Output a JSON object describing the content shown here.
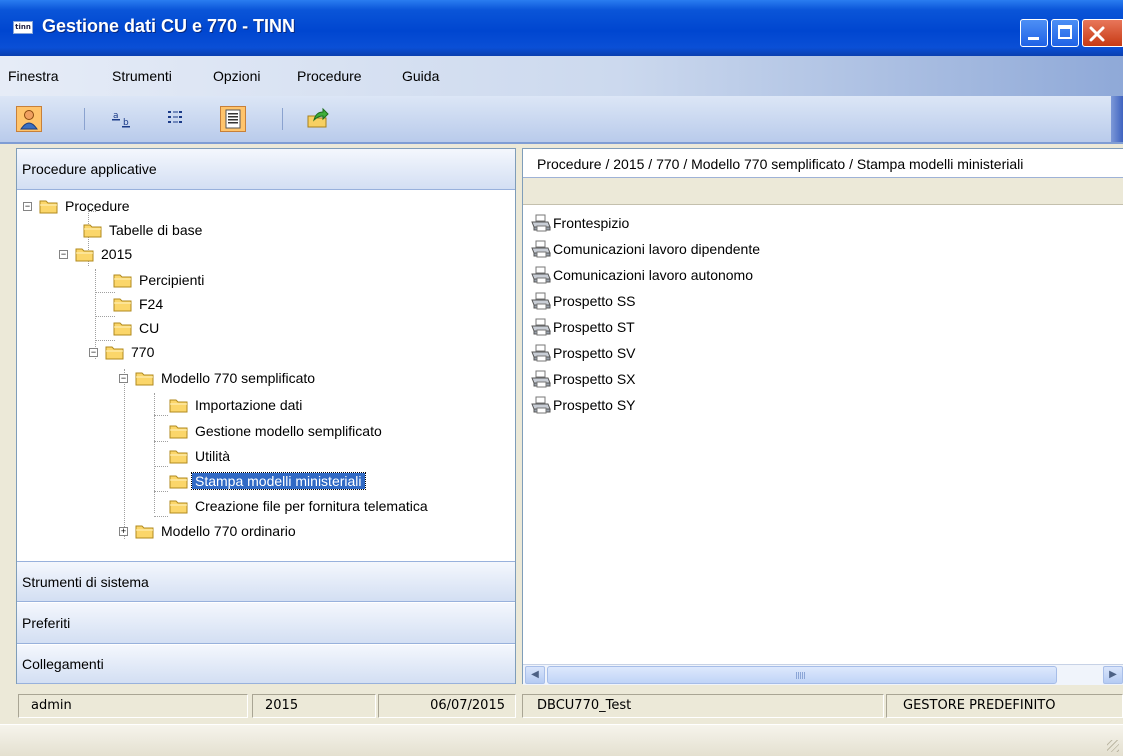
{
  "window": {
    "app_icon_text": "tinn",
    "title": "Gestione dati CU e 770 - TINN"
  },
  "menu": [
    "Finestra",
    "Strumenti",
    "Opzioni",
    "Procedure",
    "Guida"
  ],
  "toolbar": {
    "buttons": [
      "user-icon",
      "rename-icon",
      "list-view-icon",
      "details-view-icon",
      "export-icon"
    ]
  },
  "left_panel": {
    "header": "Procedure applicative",
    "tree": [
      {
        "label": "Procedure",
        "expanded": true
      },
      {
        "label": "Tabelle di base"
      },
      {
        "label": "2015",
        "expanded": true
      },
      {
        "label": "Percipienti"
      },
      {
        "label": "F24"
      },
      {
        "label": "CU"
      },
      {
        "label": "770",
        "expanded": true
      },
      {
        "label": "Modello 770 semplificato",
        "expanded": true
      },
      {
        "label": "Importazione dati"
      },
      {
        "label": "Gestione modello semplificato"
      },
      {
        "label": "Utilità"
      },
      {
        "label": "Stampa modelli ministeriali",
        "selected": true
      },
      {
        "label": "Creazione file per fornitura telematica"
      },
      {
        "label": "Modello 770 ordinario",
        "expanded": false
      }
    ],
    "sections": [
      "Strumenti di sistema",
      "Preferiti",
      "Collegamenti"
    ]
  },
  "right_panel": {
    "path": "Procedure / 2015 / 770 / Modello 770 semplificato / Stampa modelli ministeriali",
    "items": [
      "Frontespizio",
      "Comunicazioni lavoro dipendente",
      "Comunicazioni lavoro autonomo",
      "Prospetto SS",
      "Prospetto ST",
      "Prospetto SV",
      "Prospetto SX",
      "Prospetto SY"
    ],
    "item_icon": "printer-icon"
  },
  "status": {
    "user": "admin",
    "year": "2015",
    "date": "06/07/2015",
    "database": "DBCU770_Test",
    "manager": "GESTORE PREDEFINITO"
  },
  "colors": {
    "title_bar": "#0046d0",
    "selection": "#316ac5",
    "panel_header": "#d3dff3",
    "toolbar_highlight": "#ffc46b"
  }
}
